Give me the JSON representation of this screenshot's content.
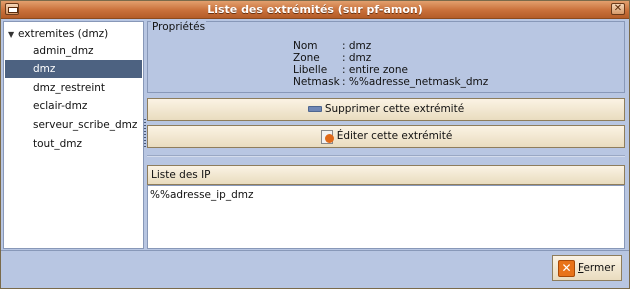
{
  "window": {
    "title": "Liste des extrémités (sur pf-amon)",
    "close_glyph": "✕"
  },
  "tree": {
    "root_label": "extremites (dmz)",
    "expander_glyph": "▼",
    "items": [
      {
        "label": "admin_dmz",
        "selected": false
      },
      {
        "label": "dmz",
        "selected": true
      },
      {
        "label": "dmz_restreint",
        "selected": false
      },
      {
        "label": "eclair-dmz",
        "selected": false
      },
      {
        "label": "serveur_scribe_dmz",
        "selected": false
      },
      {
        "label": "tout_dmz",
        "selected": false
      }
    ]
  },
  "properties": {
    "legend": "Propriétés",
    "rows": [
      {
        "label": "Nom",
        "value": ": dmz"
      },
      {
        "label": "Zone",
        "value": ": dmz"
      },
      {
        "label": "Libelle",
        "value": ": entire zone"
      },
      {
        "label": "Netmask",
        "value": ": %%adresse_netmask_dmz"
      }
    ]
  },
  "buttons": {
    "delete_label": "Supprimer cette extrémité",
    "delete_icon": "minus-icon",
    "edit_label": "Éditer cette extrémité",
    "edit_icon": "edit-icon"
  },
  "ip_list": {
    "header": "Liste des IP",
    "items": [
      "%%adresse_ip_dmz"
    ]
  },
  "footer": {
    "close_mnemonic": "F",
    "close_rest": "ermer",
    "close_icon": "close-icon"
  },
  "colors": {
    "selection": "#4d6281",
    "panel": "#b8c6e2",
    "titlebar": "#c9703a"
  }
}
